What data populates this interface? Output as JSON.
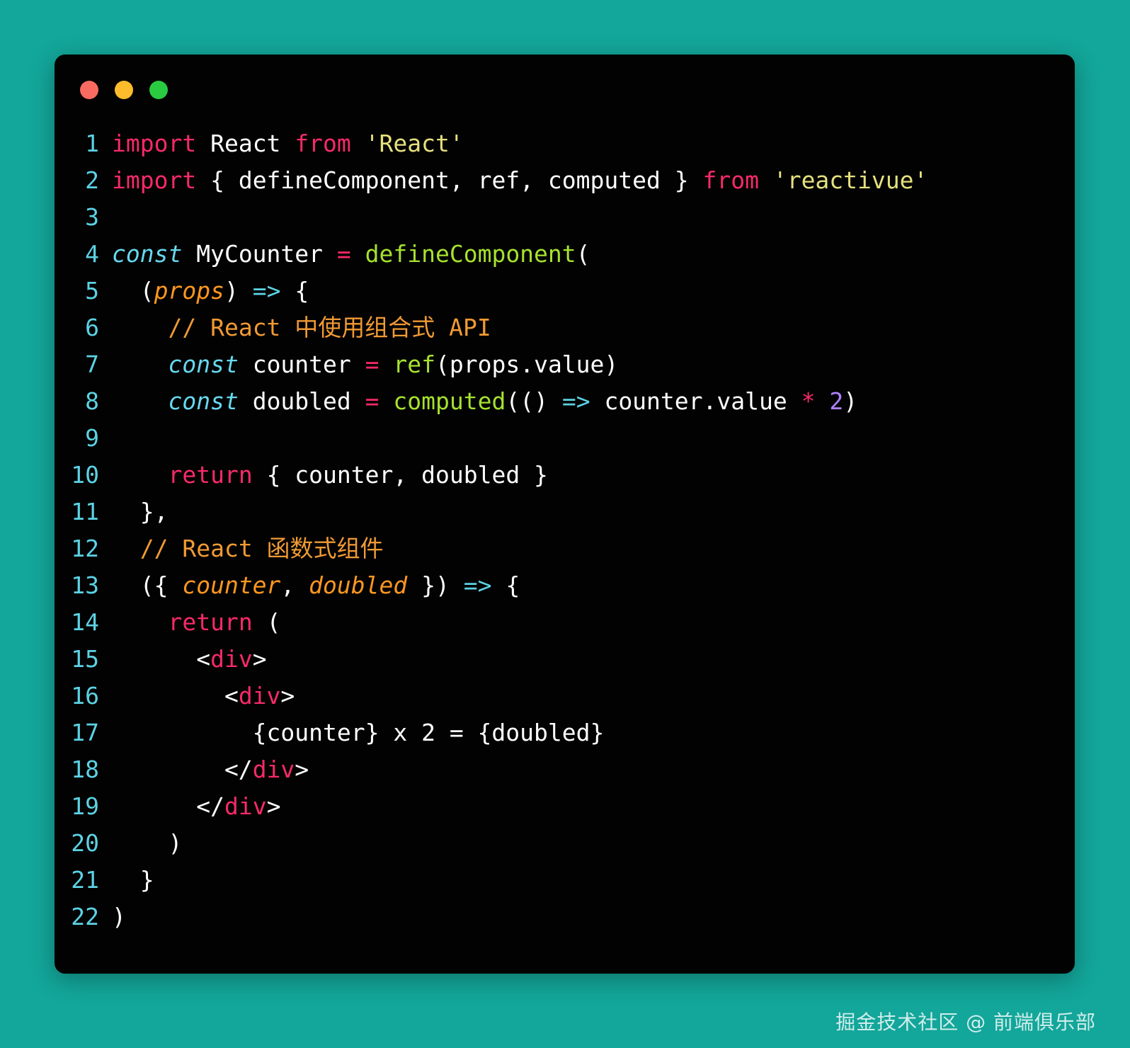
{
  "window": {
    "background_color": "#13a69a",
    "panel_color": "#020202",
    "traffic_lights": [
      {
        "name": "close",
        "color": "#f96b60"
      },
      {
        "name": "minimize",
        "color": "#fdbc2c"
      },
      {
        "name": "maximize",
        "color": "#2bcb41"
      }
    ]
  },
  "palette": {
    "line_number": "#5cd2e4",
    "plain": "#ffffff",
    "keyword": "#f72a68",
    "string": "#e6e07f",
    "function": "#a6e22e",
    "declaration": "#66d9ef",
    "parameter": "#fd9720",
    "comment": "#f09a34",
    "number": "#ae81ff",
    "arrow": "#5cd2e4",
    "tag": "#f72a68"
  },
  "code": {
    "language": "jsx",
    "lines": [
      {
        "n": "1",
        "text": "import React from 'React'"
      },
      {
        "n": "2",
        "text": "import { defineComponent, ref, computed } from 'reactivue'"
      },
      {
        "n": "3",
        "text": ""
      },
      {
        "n": "4",
        "text": "const MyCounter = defineComponent("
      },
      {
        "n": "5",
        "text": "  (props) => {"
      },
      {
        "n": "6",
        "text": "    // React 中使用组合式 API"
      },
      {
        "n": "7",
        "text": "    const counter = ref(props.value)"
      },
      {
        "n": "8",
        "text": "    const doubled = computed(() => counter.value * 2)"
      },
      {
        "n": "9",
        "text": ""
      },
      {
        "n": "10",
        "text": "    return { counter, doubled }"
      },
      {
        "n": "11",
        "text": "  },"
      },
      {
        "n": "12",
        "text": "  // React 函数式组件"
      },
      {
        "n": "13",
        "text": "  ({ counter, doubled }) => {"
      },
      {
        "n": "14",
        "text": "    return ("
      },
      {
        "n": "15",
        "text": "      <div>"
      },
      {
        "n": "16",
        "text": "        <div>"
      },
      {
        "n": "17",
        "text": "          {counter} x 2 = {doubled}"
      },
      {
        "n": "18",
        "text": "        </div>"
      },
      {
        "n": "19",
        "text": "      </div>"
      },
      {
        "n": "20",
        "text": "    )"
      },
      {
        "n": "21",
        "text": "  }"
      },
      {
        "n": "22",
        "text": ")"
      }
    ]
  },
  "watermark": {
    "text": "掘金技术社区 @ 前端俱乐部"
  }
}
